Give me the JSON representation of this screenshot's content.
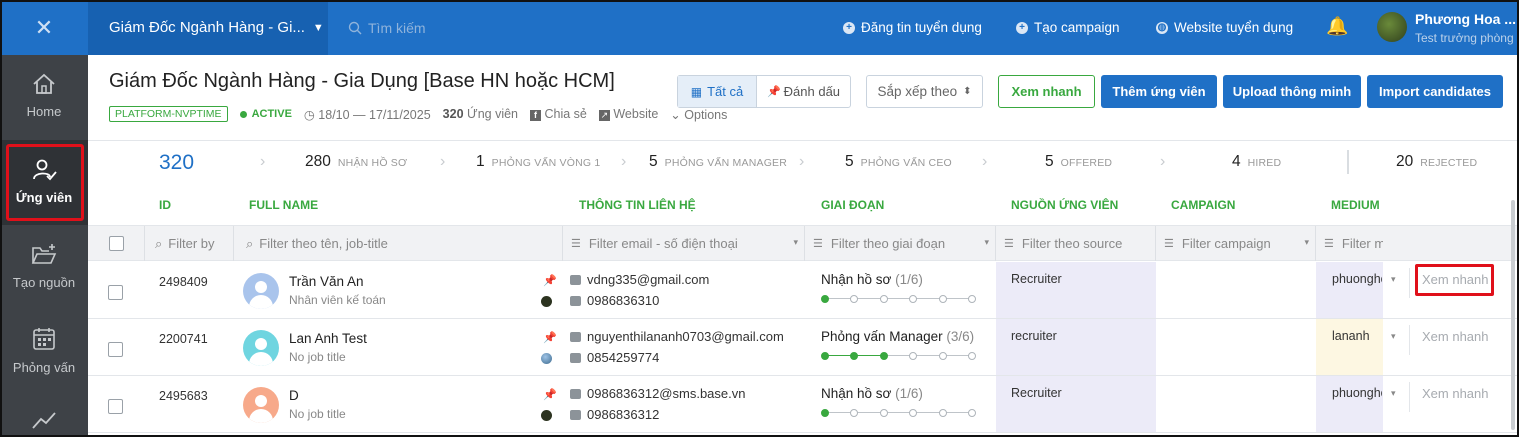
{
  "topbar": {
    "close": "✕",
    "job_selector": "Giám Đốc Ngành Hàng - Gi...",
    "search_placeholder": "Tìm kiếm",
    "links": [
      "Đăng tin tuyển dụng",
      "Tạo campaign",
      "Website tuyển dụng"
    ],
    "user_name": "Phương Hoa ...",
    "user_role": "Test trưởng phòng"
  },
  "sidebar": {
    "items": [
      {
        "label": "Home",
        "icon": "home-icon"
      },
      {
        "label": "Ứng viên",
        "icon": "user-check-icon",
        "active": true
      },
      {
        "label": "Tạo nguồn",
        "icon": "folder-plus-icon"
      },
      {
        "label": "Phỏng vấn",
        "icon": "calendar-icon"
      },
      {
        "label": "",
        "icon": "chart-line-icon"
      }
    ]
  },
  "header": {
    "title": "Giám Đốc Ngành Hàng - Gia Dụng [Base HN hoặc HCM]",
    "platform_tag": "PLATFORM-NVPTIME",
    "status": "ACTIVE",
    "dates": "18/10 — 17/11/2025",
    "candidates_count": "320",
    "candidates_label": "Ứng viên",
    "share": "Chia sẻ",
    "website": "Website",
    "options": "Options"
  },
  "toolbar": {
    "view_all": "Tất cả",
    "view_marked": "Đánh dấu",
    "sort": "Sắp xếp theo",
    "quick_view": "Xem nhanh",
    "add_candidate": "Thêm ứng viên",
    "smart_upload": "Upload thông minh",
    "import": "Import candidates"
  },
  "pipeline": [
    {
      "count": "320",
      "name": ""
    },
    {
      "count": "280",
      "name": "NHẬN HỒ SƠ"
    },
    {
      "count": "1",
      "name": "PHỎNG VẤN VÒNG 1"
    },
    {
      "count": "5",
      "name": "PHỎNG VẤN MANAGER"
    },
    {
      "count": "5",
      "name": "PHỎNG VẤN CEO"
    },
    {
      "count": "5",
      "name": "OFFERED"
    },
    {
      "count": "4",
      "name": "HIRED"
    },
    {
      "count": "20",
      "name": "REJECTED"
    }
  ],
  "table": {
    "columns": [
      "ID",
      "FULL NAME",
      "THÔNG TIN LIÊN HỆ",
      "GIAI ĐOẠN",
      "NGUỒN ỨNG VIÊN",
      "CAMPAIGN",
      "MEDIUM"
    ],
    "filters": {
      "id": "Filter by",
      "name": "Filter theo tên, job-title",
      "contact": "Filter email - số điện thoại",
      "stage": "Filter theo giai đoạn",
      "source": "Filter theo source",
      "campaign": "Filter campaign",
      "medium": "Filter m"
    },
    "rows": [
      {
        "id": "2498409",
        "name": "Trần Văn An",
        "job": "Nhân viên kế toán",
        "email": "vdng335@gmail.com",
        "phone": "0986836310",
        "stage": "Nhận hồ sơ",
        "stage_frac": "(1/6)",
        "stage_step": 1,
        "source": "Recruiter",
        "medium": "phuonghoa",
        "action": "Xem nhanh",
        "avatar_color": "#a9c4ec"
      },
      {
        "id": "2200741",
        "name": "Lan Anh Test",
        "job": "No job title",
        "email": "nguyenthilananh0703@gmail.com",
        "phone": "0854259774",
        "stage": "Phỏng vấn Manager",
        "stage_frac": "(3/6)",
        "stage_step": 3,
        "source": "recruiter",
        "medium": "lananh",
        "action": "Xem nhanh",
        "avatar_color": "#6fd5e0"
      },
      {
        "id": "2495683",
        "name": "D",
        "job": "No job title",
        "email": "0986836312@sms.base.vn",
        "phone": "0986836312",
        "stage": "Nhận hồ sơ",
        "stage_frac": "(1/6)",
        "stage_step": 1,
        "source": "Recruiter",
        "medium": "phuonghoa",
        "action": "Xem nhanh",
        "avatar_color": "#f7a98a"
      }
    ]
  },
  "colors": {
    "brand": "#1f70c6",
    "success": "#39a83f",
    "highlight": "#e0101a",
    "sidebar": "#3e4247"
  }
}
